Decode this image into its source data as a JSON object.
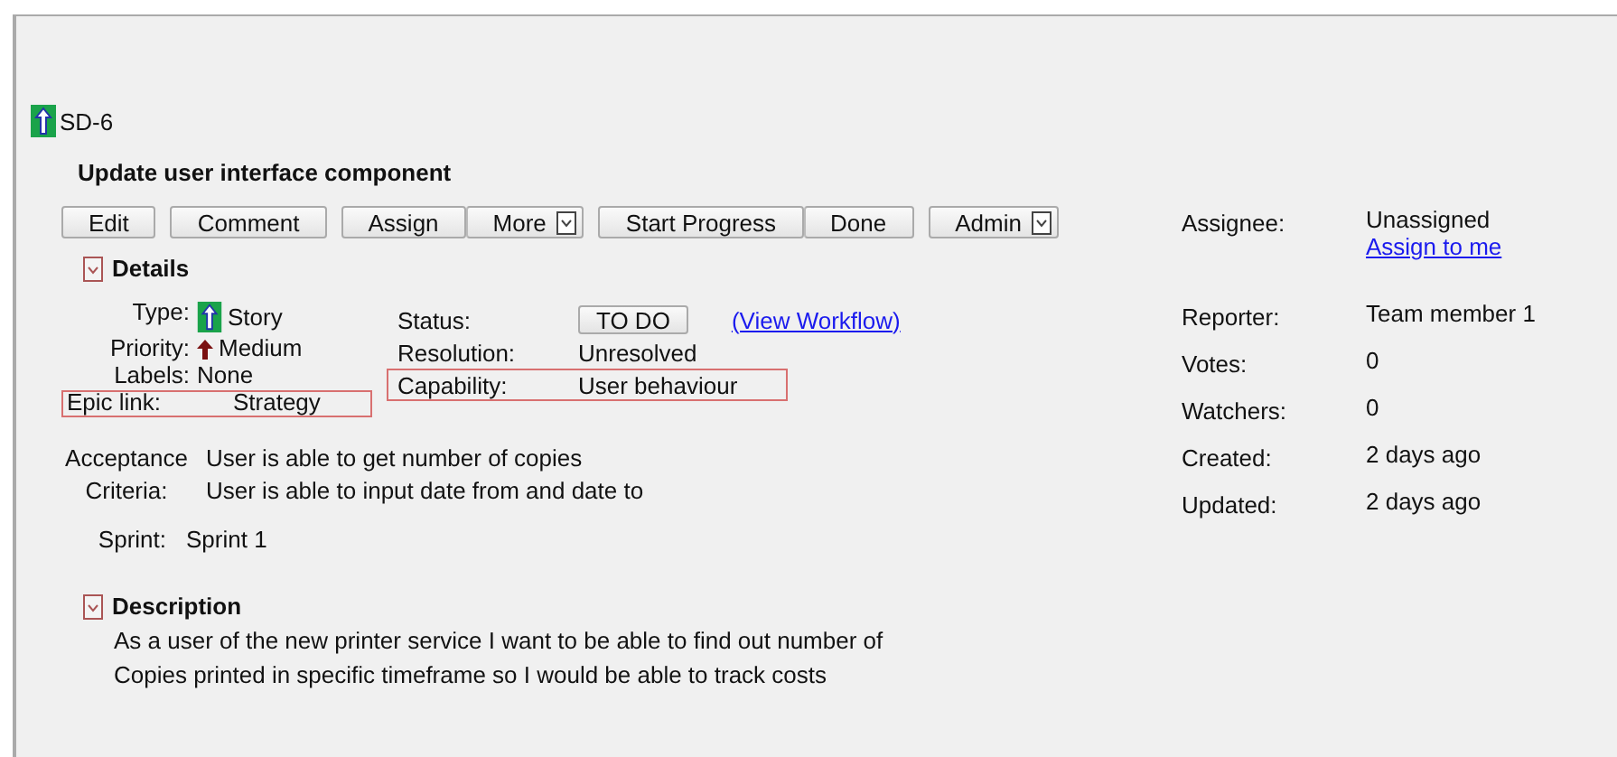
{
  "issue": {
    "key": "SD-6",
    "title": "Update user interface component"
  },
  "button_groups": [
    [
      {
        "label": "Edit",
        "dropdown": false
      }
    ],
    [
      {
        "label": "Comment",
        "dropdown": false
      }
    ],
    [
      {
        "label": "Assign",
        "dropdown": false
      },
      {
        "label": "More",
        "dropdown": true
      }
    ],
    [
      {
        "label": "Start Progress",
        "dropdown": false
      },
      {
        "label": "Done",
        "dropdown": false
      }
    ],
    [
      {
        "label": "Admin",
        "dropdown": true
      }
    ]
  ],
  "details": {
    "heading": "Details",
    "expanded": true,
    "left_fields": [
      {
        "label": "Type:",
        "value": "Story",
        "kind": "type",
        "highlighted": false
      },
      {
        "label": "Priority:",
        "value": "Medium",
        "kind": "priority",
        "highlighted": false
      },
      {
        "label": "Labels:",
        "value": "None",
        "kind": "plain",
        "highlighted": false
      },
      {
        "label": "Epic link:",
        "value": "Strategy",
        "kind": "plain",
        "highlighted": true
      }
    ],
    "middle_fields": [
      {
        "label": "Status:",
        "value": "TO DO",
        "kind": "status",
        "link": "(View Workflow)",
        "highlighted": false
      },
      {
        "label": "Resolution:",
        "value": "Unresolved",
        "kind": "plain",
        "highlighted": false
      },
      {
        "label": "Capability:",
        "value": "User behaviour",
        "kind": "plain",
        "highlighted": true
      }
    ],
    "acceptance": {
      "label": "Acceptance Criteria:",
      "lines": [
        "User is able to get number of copies",
        "User is able to input date from and date to"
      ]
    },
    "sprint": {
      "label": "Sprint:",
      "value": "Sprint 1"
    }
  },
  "description": {
    "heading": "Description",
    "expanded": true,
    "text": "As a user of the new printer service I want to be able to find out number of Copies printed in specific timeframe so I would be able to track costs"
  },
  "people": [
    {
      "label": "Assignee:",
      "value": "Unassigned",
      "link": "Assign to me"
    },
    {
      "label": "Reporter:",
      "value": "Team member 1"
    },
    {
      "label": "Votes:",
      "value": "0"
    },
    {
      "label": "Watchers:",
      "value": "0"
    },
    {
      "label": "Created:",
      "value": "2 days ago"
    },
    {
      "label": "Updated:",
      "value": "2 days ago"
    }
  ]
}
